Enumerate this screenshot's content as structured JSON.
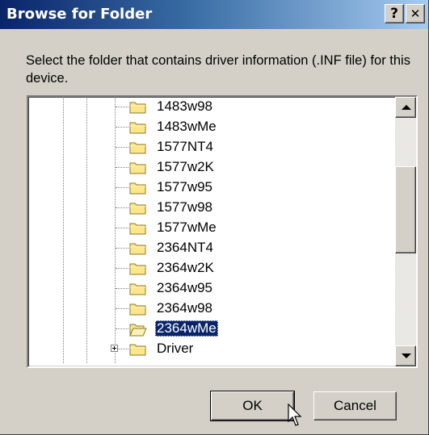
{
  "window": {
    "title": "Browse for Folder",
    "help_label": "?",
    "close_label": "✕"
  },
  "instruction": "Select the folder that contains driver information (.INF file) for this device.",
  "tree": {
    "items": [
      {
        "label": "1483w98"
      },
      {
        "label": "1483wMe"
      },
      {
        "label": "1577NT4"
      },
      {
        "label": "1577w2K"
      },
      {
        "label": "1577w95"
      },
      {
        "label": "1577w98"
      },
      {
        "label": "1577wMe"
      },
      {
        "label": "2364NT4"
      },
      {
        "label": "2364w2K"
      },
      {
        "label": "2364w95"
      },
      {
        "label": "2364w98"
      },
      {
        "label": "2364wMe",
        "selected": true
      },
      {
        "label": "Driver",
        "expandable": true
      }
    ]
  },
  "buttons": {
    "ok_label": "OK",
    "cancel_label": "Cancel"
  },
  "colors": {
    "title_start": "#0a246a",
    "title_end": "#a6caf0",
    "face": "#d4d0c8",
    "selection": "#0a246a",
    "folder_fill": "#fde58a",
    "folder_stroke": "#8a7a30"
  }
}
